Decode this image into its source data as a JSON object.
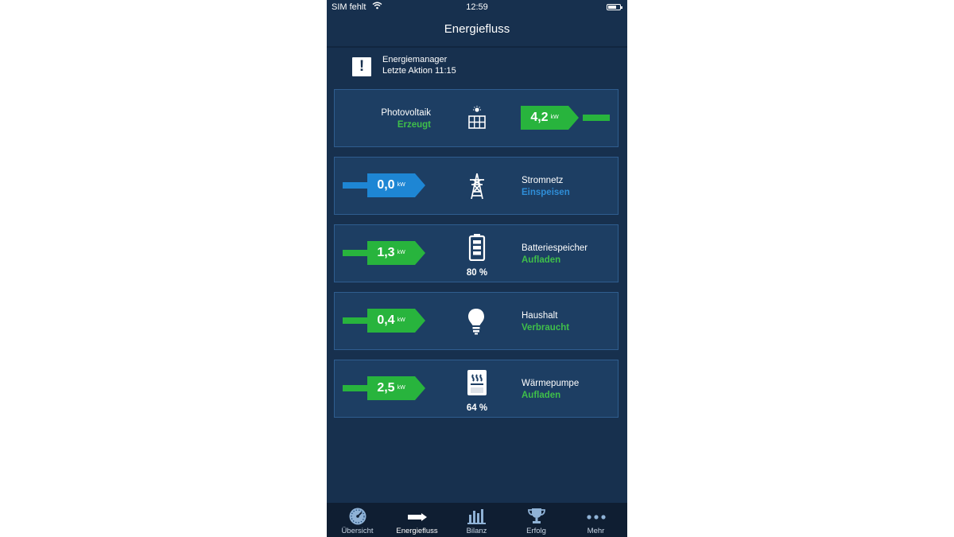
{
  "status_bar": {
    "carrier": "SIM fehlt",
    "time": "12:59"
  },
  "header": {
    "title": "Energiefluss"
  },
  "manager": {
    "title": "Energiemanager",
    "subtitle": "Letzte Aktion 11:15",
    "icon": "alert-icon"
  },
  "cards": [
    {
      "label": "Photovoltaik",
      "status": "Erzeugt",
      "value": "4,2",
      "unit": "kW",
      "icon": "solar-panel-icon",
      "color": "#28b43d"
    },
    {
      "label": "Stromnetz",
      "status": "Einspeisen",
      "value": "0,0",
      "unit": "kW",
      "icon": "power-tower-icon",
      "color": "#1e86d4"
    },
    {
      "label": "Batteriespeicher",
      "status": "Aufladen",
      "value": "1,3",
      "unit": "kW",
      "icon": "battery-icon",
      "percent": "80 %",
      "color": "#28b43d"
    },
    {
      "label": "Haushalt",
      "status": "Verbraucht",
      "value": "0,4",
      "unit": "kW",
      "icon": "light-bulb-icon",
      "color": "#28b43d"
    },
    {
      "label": "Wärmepumpe",
      "status": "Aufladen",
      "value": "2,5",
      "unit": "kW",
      "icon": "heat-pump-icon",
      "percent": "64 %",
      "color": "#28b43d"
    }
  ],
  "tabs": [
    {
      "label": "Übersicht",
      "icon": "gauge-icon"
    },
    {
      "label": "Energiefluss",
      "icon": "flow-icon",
      "active": true
    },
    {
      "label": "Bilanz",
      "icon": "bar-chart-icon"
    },
    {
      "label": "Erfolg",
      "icon": "trophy-icon"
    },
    {
      "label": "Mehr",
      "icon": "more-dots-icon"
    }
  ],
  "colors": {
    "background": "#17304e",
    "card": "#1d3e63",
    "green": "#28b43d",
    "blue": "#1e86d4",
    "tabbar": "#0f1e32"
  }
}
